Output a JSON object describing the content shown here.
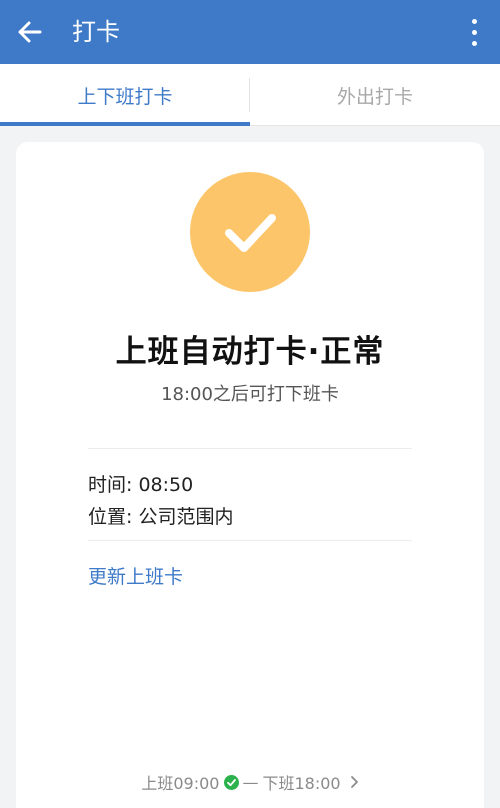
{
  "header": {
    "title": "打卡",
    "back_icon": "arrow-left-icon",
    "more_icon": "more-vertical-icon"
  },
  "tabs": [
    {
      "label": "上下班打卡",
      "active": true
    },
    {
      "label": "外出打卡",
      "active": false
    }
  ],
  "status": {
    "icon": "checkmark-icon",
    "title": "上班自动打卡·正常",
    "subtitle": "18:00之后可打下班卡"
  },
  "details": {
    "time_label": "时间:",
    "time_value": "08:50",
    "location_label": "位置:",
    "location_value": "公司范围内"
  },
  "actions": {
    "update_label": "更新上班卡"
  },
  "footer": {
    "clock_in": "上班09:00",
    "separator": "—",
    "clock_out": "下班18:00",
    "clock_in_status": "check-circle-icon",
    "chevron": "chevron-right-icon"
  },
  "colors": {
    "primary": "#3f7ac9",
    "check_circle": "#fcc56a",
    "success": "#2bb24c"
  }
}
